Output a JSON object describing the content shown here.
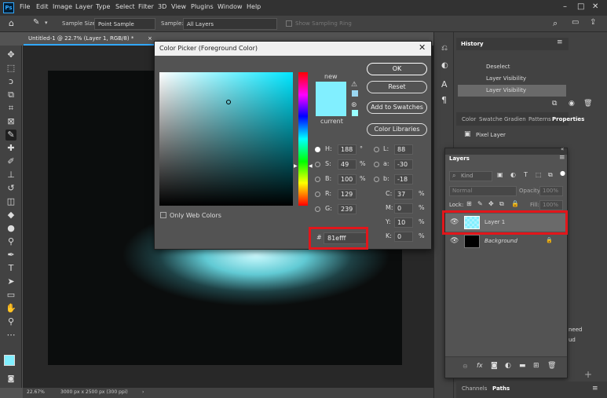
{
  "menubar": {
    "logo": "Ps",
    "items": [
      "File",
      "Edit",
      "Image",
      "Layer",
      "Type",
      "Select",
      "Filter",
      "3D",
      "View",
      "Plugins",
      "Window",
      "Help"
    ],
    "window_controls": [
      "–",
      "□",
      "✕"
    ]
  },
  "options": {
    "sample_size_label": "Sample Size:",
    "sample_size_value": "Point Sample",
    "sample_label": "Sample:",
    "sample_value": "All Layers",
    "show_ring": "Show Sampling Ring"
  },
  "document": {
    "tab_title": "Untitled-1 @ 22.7% (Layer 1, RGB/8) *",
    "zoom": "22.67%",
    "doc_info": "3000 px x 2500 px (300 ppi)"
  },
  "dialog": {
    "title": "Color Picker (Foreground Color)",
    "new_label": "new",
    "current_label": "current",
    "new_color": "#81efff",
    "current_color": "#81efff",
    "buttons": {
      "ok": "OK",
      "reset": "Reset",
      "add_swatches": "Add to Swatches",
      "color_libraries": "Color Libraries"
    },
    "only_web": "Only Web Colors",
    "hsb": [
      {
        "label": "H:",
        "value": "188",
        "unit": "°",
        "on": true
      },
      {
        "label": "S:",
        "value": "49",
        "unit": "%",
        "on": false
      },
      {
        "label": "B:",
        "value": "100",
        "unit": "%",
        "on": false
      }
    ],
    "rgb": [
      {
        "label": "R:",
        "value": "129"
      },
      {
        "label": "G:",
        "value": "239"
      },
      {
        "label": "B:",
        "value": "255"
      }
    ],
    "lab": [
      {
        "label": "L:",
        "value": "88"
      },
      {
        "label": "a:",
        "value": "-30"
      },
      {
        "label": "b:",
        "value": "-18"
      }
    ],
    "cmyk": [
      {
        "label": "C:",
        "value": "37"
      },
      {
        "label": "M:",
        "value": "0"
      },
      {
        "label": "Y:",
        "value": "10"
      },
      {
        "label": "K:",
        "value": "0"
      }
    ],
    "hex_label": "#",
    "hex_value": "81efff"
  },
  "history": {
    "title": "History",
    "items": [
      "Deselect",
      "Layer Visibility",
      "Layer Visibility"
    ]
  },
  "properties": {
    "tabs": [
      "Color",
      "Swatche",
      "Gradien",
      "Patterns",
      "Properties"
    ],
    "pixel_layer": "Pixel Layer"
  },
  "layers": {
    "title": "Layers",
    "kind": "Kind",
    "blend": "Normal",
    "opacity_label": "Opacity:",
    "opacity": "100%",
    "lock_label": "Lock:",
    "fill_label": "Fill:",
    "fill": "100%",
    "items": [
      {
        "name": "Layer 1",
        "italic": false
      },
      {
        "name": "Background",
        "italic": true
      }
    ]
  },
  "bottom_tabs": [
    "Channels",
    "Paths"
  ],
  "partial_text": [
    "need",
    "ud"
  ]
}
